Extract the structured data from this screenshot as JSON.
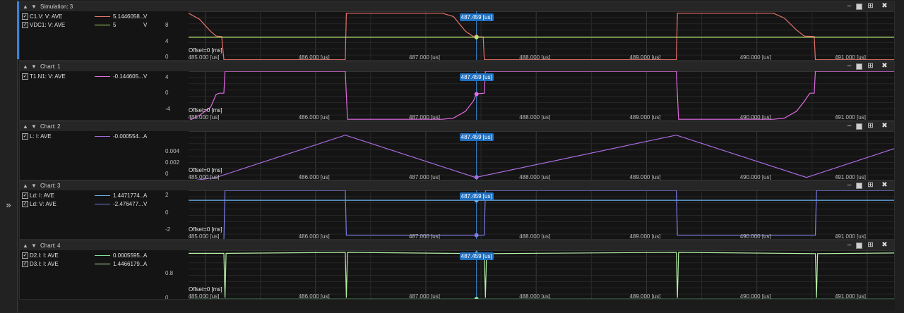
{
  "window": {
    "expander_icon": "double-chevron-right-icon"
  },
  "cursor": {
    "time_us": 487.459,
    "label": "487.459 [us]"
  },
  "x_axis": {
    "range_us": [
      484.85,
      491.25
    ],
    "ticks": [
      {
        "v": 485,
        "label": "485.000 [us]"
      },
      {
        "v": 486,
        "label": "486.000 [us]"
      },
      {
        "v": 487,
        "label": "487.000 [us]"
      },
      {
        "v": 488,
        "label": "488.000 [us]"
      },
      {
        "v": 489,
        "label": "489.000 [us]"
      },
      {
        "v": 490,
        "label": "490.000 [us]"
      },
      {
        "v": 491,
        "label": "491.000 [us]"
      }
    ]
  },
  "offset_label": "Offset=0 [ms]",
  "panels": [
    {
      "title": "Simulation: 3",
      "legend": [
        {
          "name": "C1.V: V: AVE",
          "value": "5.1446058...",
          "unit": "V",
          "color": "#e8726c"
        },
        {
          "name": "VDC1: V: AVE",
          "value": "5",
          "unit": "V",
          "color": "#b7e36b"
        }
      ],
      "y_ticks": [
        {
          "v": 8,
          "label": "8"
        },
        {
          "v": 4,
          "label": "4"
        },
        {
          "v": 0,
          "label": "0"
        }
      ],
      "ylim": [
        -1,
        11.5
      ]
    },
    {
      "title": "Chart: 1",
      "legend": [
        {
          "name": "T1.N1: V: AVE",
          "value": "-0.144605...",
          "unit": "V",
          "color": "#e36be3"
        }
      ],
      "y_ticks": [
        {
          "v": 4,
          "label": "4"
        },
        {
          "v": 0,
          "label": "0"
        },
        {
          "v": -4,
          "label": "-4"
        }
      ],
      "ylim": [
        -7,
        5.5
      ]
    },
    {
      "title": "Chart: 2",
      "legend": [
        {
          "name": "L: I: AVE",
          "value": "-0.000554...",
          "unit": "A",
          "color": "#a86be0"
        }
      ],
      "y_ticks": [
        {
          "v": 0.004,
          "label": "0.004"
        },
        {
          "v": 0.002,
          "label": "0.002"
        },
        {
          "v": 0,
          "label": "0"
        }
      ],
      "ylim": [
        -0.0012,
        0.0075
      ]
    },
    {
      "title": "Chart: 3",
      "legend": [
        {
          "name": "Ld: I: AVE",
          "value": "1.4471774...",
          "unit": "A",
          "color": "#6db3f2"
        },
        {
          "name": "Ld: V: AVE",
          "value": "-2.476477...",
          "unit": "V",
          "color": "#7d7de8"
        }
      ],
      "y_ticks": [
        {
          "v": 2,
          "label": "2"
        },
        {
          "v": 0,
          "label": "0"
        },
        {
          "v": -2,
          "label": "-2"
        }
      ],
      "ylim": [
        -3.2,
        2.6
      ]
    },
    {
      "title": "Chart: 4",
      "legend": [
        {
          "name": "D2.I: I: AVE",
          "value": "0.0005595...",
          "unit": "A",
          "color": "#7ee39a"
        },
        {
          "name": "D3.I: I: AVE",
          "value": "1.4466179...",
          "unit": "A",
          "color": "#b6f0a8"
        }
      ],
      "y_ticks": [
        {
          "v": 0.8,
          "label": "0.8"
        },
        {
          "v": 0,
          "label": "0"
        }
      ],
      "ylim": [
        -0.08,
        1.55
      ]
    }
  ],
  "chart_data": [
    {
      "type": "line",
      "title": "Simulation: 3",
      "xlabel": "",
      "ylabel": "",
      "ylim": [
        -1,
        11.5
      ],
      "series": [
        {
          "name": "C1.V: V: AVE",
          "points": [
            [
              484.85,
              11
            ],
            [
              484.95,
              9.5
            ],
            [
              485.05,
              6.5
            ],
            [
              485.1,
              5.3
            ],
            [
              485.15,
              5.2
            ],
            [
              485.17,
              -0.6
            ],
            [
              486.27,
              -0.6
            ],
            [
              486.28,
              11
            ],
            [
              487.15,
              11
            ],
            [
              487.25,
              10.2
            ],
            [
              487.36,
              6.5
            ],
            [
              487.43,
              5.2
            ],
            [
              487.52,
              5.1
            ],
            [
              487.53,
              -0.6
            ],
            [
              489.27,
              -0.6
            ],
            [
              489.28,
              11
            ],
            [
              490.15,
              11
            ],
            [
              490.25,
              9.8
            ],
            [
              490.36,
              6.8
            ],
            [
              490.43,
              5.3
            ],
            [
              490.52,
              5.2
            ],
            [
              490.53,
              -0.6
            ],
            [
              491.25,
              -0.6
            ]
          ]
        },
        {
          "name": "VDC1: V: AVE",
          "points": [
            [
              484.85,
              5
            ],
            [
              491.25,
              5
            ]
          ]
        }
      ]
    },
    {
      "type": "line",
      "title": "Chart: 1",
      "xlabel": "",
      "ylabel": "",
      "ylim": [
        -7,
        5.5
      ],
      "series": [
        {
          "name": "T1.N1: V: AVE",
          "points": [
            [
              484.85,
              -6.9
            ],
            [
              484.95,
              -5.5
            ],
            [
              485.05,
              -3.5
            ],
            [
              485.1,
              -0.3
            ],
            [
              485.13,
              0
            ],
            [
              485.17,
              0
            ],
            [
              485.18,
              5.5
            ],
            [
              486.27,
              5.5
            ],
            [
              486.28,
              -0.4
            ],
            [
              486.29,
              -6.5
            ],
            [
              487.15,
              -6.5
            ],
            [
              487.25,
              -6.2
            ],
            [
              487.36,
              -4.5
            ],
            [
              487.43,
              -2
            ],
            [
              487.46,
              -0.15
            ],
            [
              487.53,
              0
            ],
            [
              487.54,
              5.5
            ],
            [
              489.27,
              5.5
            ],
            [
              489.28,
              -0.4
            ],
            [
              489.29,
              -6.5
            ],
            [
              490.15,
              -6.5
            ],
            [
              490.25,
              -6.2
            ],
            [
              490.36,
              -4.5
            ],
            [
              490.43,
              -2
            ],
            [
              490.48,
              0
            ],
            [
              490.52,
              0
            ],
            [
              490.53,
              5.5
            ],
            [
              491.25,
              5.5
            ]
          ]
        }
      ]
    },
    {
      "type": "line",
      "title": "Chart: 2",
      "xlabel": "",
      "ylabel": "",
      "ylim": [
        -0.0012,
        0.0075
      ],
      "series": [
        {
          "name": "L: I: AVE",
          "points": [
            [
              484.85,
              -0.0012
            ],
            [
              485.1,
              -0.00055
            ],
            [
              486.27,
              0.0068
            ],
            [
              487.45,
              -0.00055
            ],
            [
              489.27,
              0.0068
            ],
            [
              490.45,
              -0.00055
            ],
            [
              491.25,
              0.0045
            ]
          ]
        }
      ]
    },
    {
      "type": "line",
      "title": "Chart: 3",
      "xlabel": "",
      "ylabel": "",
      "ylim": [
        -3.2,
        2.6
      ],
      "series": [
        {
          "name": "Ld: I: AVE",
          "points": [
            [
              484.85,
              1.45
            ],
            [
              491.25,
              1.45
            ]
          ]
        },
        {
          "name": "Ld: V: AVE",
          "points": [
            [
              484.85,
              -3.2
            ],
            [
              485.17,
              -3.2
            ],
            [
              485.18,
              2.6
            ],
            [
              486.27,
              2.6
            ],
            [
              486.28,
              -2.6
            ],
            [
              487.53,
              -2.6
            ],
            [
              487.54,
              2.6
            ],
            [
              489.27,
              2.6
            ],
            [
              489.28,
              -2.6
            ],
            [
              490.53,
              -2.6
            ],
            [
              490.54,
              2.6
            ],
            [
              491.25,
              2.6
            ]
          ]
        }
      ]
    },
    {
      "type": "line",
      "title": "Chart: 4",
      "xlabel": "",
      "ylabel": "",
      "ylim": [
        -0.08,
        1.55
      ],
      "series": [
        {
          "name": "D2.I: I: AVE",
          "points": [
            [
              484.85,
              -0.04
            ],
            [
              491.25,
              -0.04
            ]
          ]
        },
        {
          "name": "D3.I: I: AVE",
          "points": [
            [
              484.85,
              1.45
            ],
            [
              485.17,
              1.45
            ],
            [
              485.18,
              0
            ],
            [
              485.19,
              1.45
            ],
            [
              486.27,
              1.48
            ],
            [
              486.28,
              0
            ],
            [
              486.29,
              1.48
            ],
            [
              487.53,
              1.44
            ],
            [
              487.54,
              0
            ],
            [
              487.55,
              1.44
            ],
            [
              489.27,
              1.48
            ],
            [
              489.28,
              0
            ],
            [
              489.29,
              1.48
            ],
            [
              490.53,
              1.44
            ],
            [
              490.54,
              0
            ],
            [
              490.55,
              1.44
            ],
            [
              491.25,
              1.46
            ]
          ]
        }
      ]
    }
  ]
}
